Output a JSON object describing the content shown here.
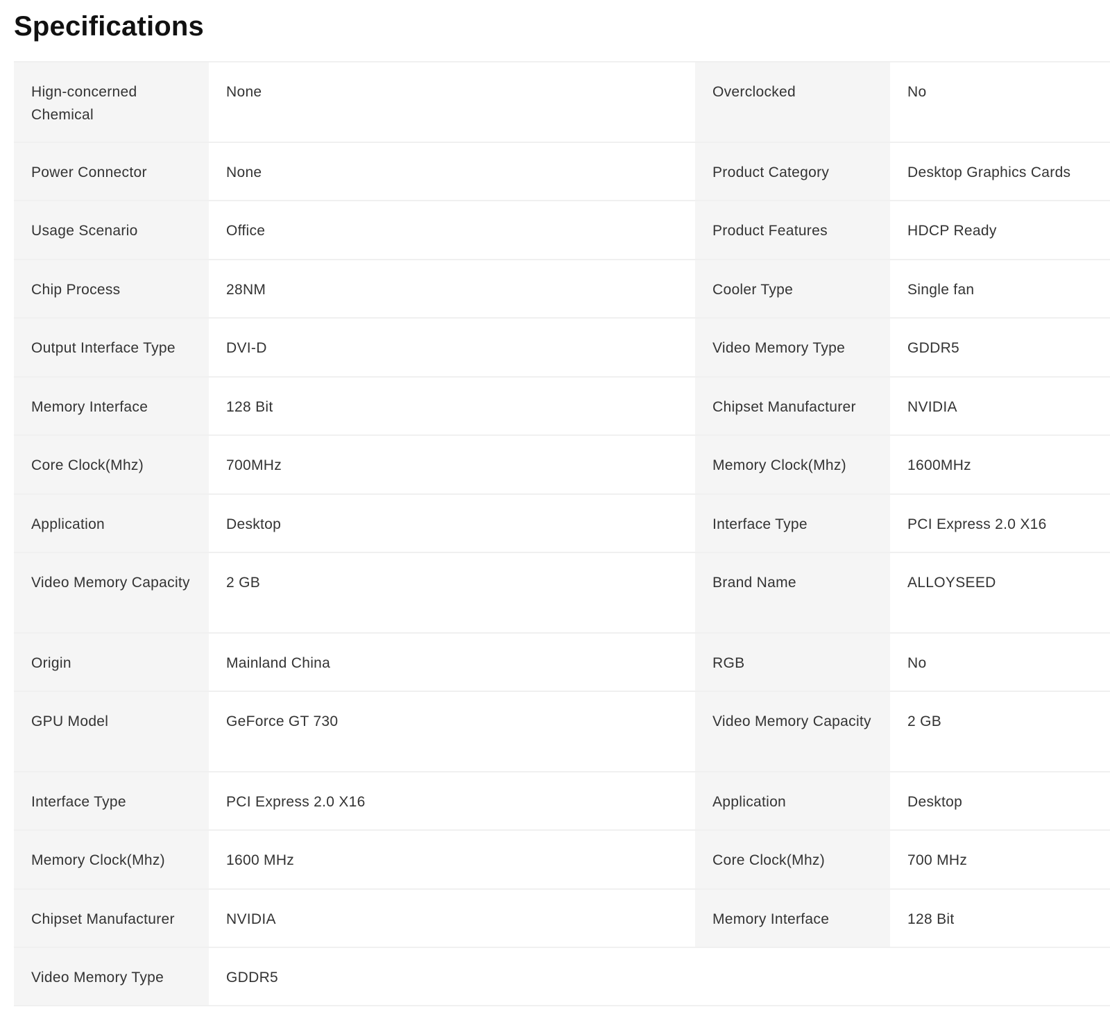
{
  "page": {
    "title": "Specifications"
  },
  "specs": [
    {
      "l1": "Hign-concerned Chemical",
      "v1": "None",
      "l2": "Overclocked",
      "v2": "No"
    },
    {
      "l1": "Power Connector",
      "v1": "None",
      "l2": "Product Category",
      "v2": "Desktop Graphics Cards"
    },
    {
      "l1": "Usage Scenario",
      "v1": "Office",
      "l2": "Product Features",
      "v2": "HDCP Ready"
    },
    {
      "l1": "Chip Process",
      "v1": "28NM",
      "l2": "Cooler Type",
      "v2": "Single fan"
    },
    {
      "l1": "Output Interface Type",
      "v1": "DVI-D",
      "l2": "Video Memory Type",
      "v2": "GDDR5"
    },
    {
      "l1": "Memory Interface",
      "v1": "128 Bit",
      "l2": "Chipset Manufacturer",
      "v2": "NVIDIA"
    },
    {
      "l1": "Core Clock(Mhz)",
      "v1": "700MHz",
      "l2": "Memory Clock(Mhz)",
      "v2": "1600MHz"
    },
    {
      "l1": "Application",
      "v1": "Desktop",
      "l2": "Interface Type",
      "v2": "PCI Express 2.0 X16"
    },
    {
      "l1": "Video Memory Capacity",
      "v1": "2 GB",
      "l2": "Brand Name",
      "v2": "ALLOYSEED"
    },
    {
      "l1": "Origin",
      "v1": "Mainland China",
      "l2": "RGB",
      "v2": "No"
    },
    {
      "l1": "GPU Model",
      "v1": "GeForce GT 730",
      "l2": "Video Memory Capacity",
      "v2": "2 GB"
    },
    {
      "l1": "Interface Type",
      "v1": "PCI Express 2.0 X16",
      "l2": "Application",
      "v2": "Desktop"
    },
    {
      "l1": "Memory Clock(Mhz)",
      "v1": "1600 MHz",
      "l2": "Core Clock(Mhz)",
      "v2": "700 MHz"
    },
    {
      "l1": "Chipset Manufacturer",
      "v1": "NVIDIA",
      "l2": "Memory Interface",
      "v2": "128 Bit"
    },
    {
      "l1": "Video Memory Type",
      "v1": "GDDR5",
      "l2": null,
      "v2": null
    }
  ]
}
